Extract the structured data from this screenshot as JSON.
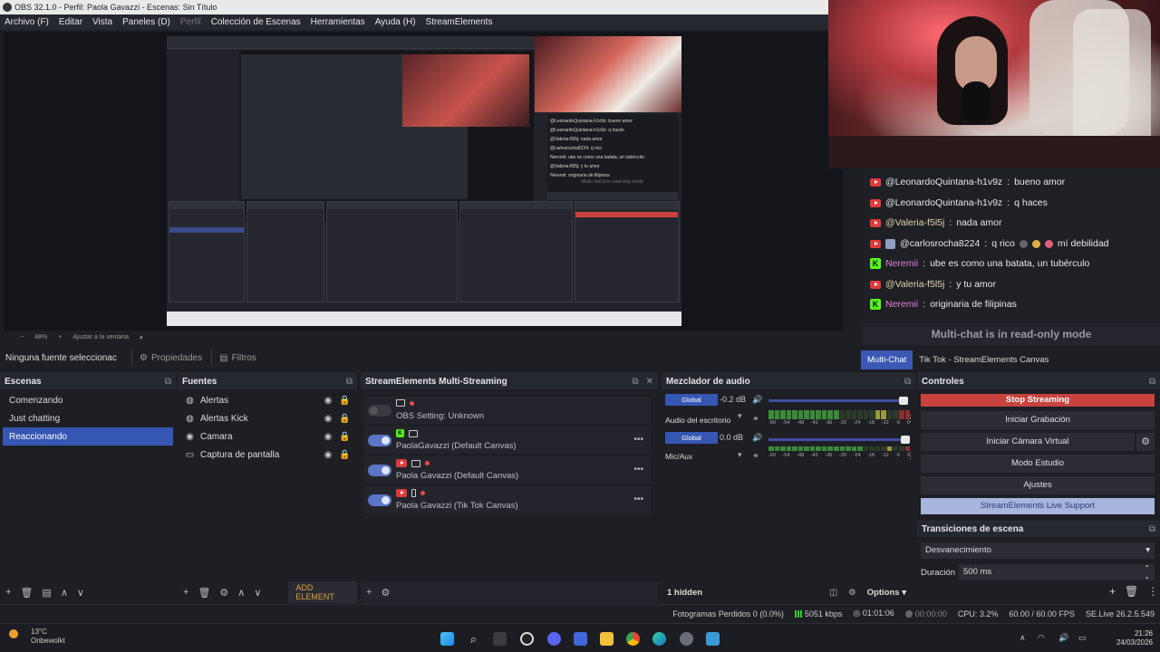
{
  "window": {
    "title": "OBS 32.1.0 - Perfil: Paola Gavazzi - Escenas: Sin Título"
  },
  "menu": {
    "items": [
      "Archivo (F)",
      "Editar",
      "Vista",
      "Paneles (D)",
      "Perfil",
      "Colección de Escenas",
      "Herramientas",
      "Ayuda (H)",
      "StreamElements"
    ]
  },
  "preview": {
    "zoom": "48%",
    "fit_label": "Ajustar a la ventana",
    "nested_chat": [
      "@LeonardoQuintana-h1v9z: bueno amor",
      "@LeonardoQuintana-h1v9z: q hacés",
      "@Valeria-f5l5j: nada amor",
      "@carlosrocha8224: q rico",
      "Neremii: ube es como una batata, un tubérculo",
      "@Valeria-f5l5j: y tu amor",
      "Neremii: originaria de filipinas"
    ],
    "nested_readonly": "Multi-chat is in read-only mode"
  },
  "chat": {
    "messages": [
      {
        "platform": "youtube",
        "user": "@LeonardoQuintana-h1v9z",
        "text": "bueno amor"
      },
      {
        "platform": "youtube",
        "user": "@LeonardoQuintana-h1v9z",
        "text": "q haces"
      },
      {
        "platform": "youtube",
        "user": "@Valeria-f5l5j",
        "text": "nada amor"
      },
      {
        "platform": "youtube",
        "user": "@carlosrocha8224",
        "text": "q rico",
        "text2": "mí debilidad"
      },
      {
        "platform": "kick",
        "user": "Neremii",
        "text": "ube es como una batata, un tubérculo"
      },
      {
        "platform": "youtube",
        "user": "@Valeria-f5l5j",
        "text": "y tu amor"
      },
      {
        "platform": "kick",
        "user": "Neremii",
        "text": "originaria de filipinas"
      }
    ],
    "readonly": "Multi-chat is in read-only mode",
    "tabs": [
      "Multi-Chat",
      "Tik Tok - StreamElements Canvas"
    ]
  },
  "source_toolbar": {
    "no_source": "Ninguna fuente seleccionac",
    "properties": "Propiedades",
    "filters": "Filtros"
  },
  "scenes": {
    "title": "Escenas",
    "items": [
      "Comenzando",
      "Just chatting",
      "Reaccionando"
    ],
    "selected": 2
  },
  "sources": {
    "title": "Fuentes",
    "items": [
      {
        "name": "Alertas",
        "icon": "browser-icon"
      },
      {
        "name": "Alertas Kick",
        "icon": "browser-icon"
      },
      {
        "name": "Camara",
        "icon": "camera-icon"
      },
      {
        "name": "Captura de pantalla",
        "icon": "monitor-icon"
      }
    ],
    "add_element": "ADD ELEMENT"
  },
  "multistream": {
    "title": "StreamElements Multi-Streaming",
    "rows": [
      {
        "label": "OBS Setting: Unknown",
        "enabled": false,
        "platform": "obs"
      },
      {
        "label": "PaolaGavazzi (Default Canvas)",
        "enabled": true,
        "platform": "kick"
      },
      {
        "label": "Paola Gavazzi (Default Canvas)",
        "enabled": true,
        "platform": "youtube"
      },
      {
        "label": "Paola Gavazzi (Tik Tok Canvas)",
        "enabled": true,
        "platform": "youtube"
      }
    ]
  },
  "mixer": {
    "title": "Mezclador de audio",
    "channels": [
      {
        "scope": "Global",
        "db": "-0.2 dB",
        "name": "Audio del escritorio",
        "level": 0.99
      },
      {
        "scope": "Global",
        "db": "0.0 dB",
        "name": "Mic/Aux",
        "level": 1.0
      }
    ],
    "scale": [
      "-60",
      "-54",
      "-48",
      "-42",
      "-36",
      "-30",
      "-24",
      "-18",
      "-12",
      "-6",
      "0"
    ],
    "hidden": "1 hidden",
    "options": "Options"
  },
  "controls": {
    "title": "Controles",
    "stop_streaming": "Stop Streaming",
    "start_recording": "Iniciar Grabación",
    "virtual_cam": "Iniciar Cámara Virtual",
    "studio_mode": "Modo Estudio",
    "settings": "Ajustes",
    "live_support": "StreamElements Live Support"
  },
  "transitions": {
    "title": "Transiciones de escena",
    "selected": "Desvanecimiento",
    "duration_label": "Duración",
    "duration": "500 ms"
  },
  "status": {
    "dropped": "Fotogramas Perdidos 0 (0.0%)",
    "bitrate": "5051 kbps",
    "live_time": "01:01:06",
    "rec_time": "00:00:00",
    "cpu": "CPU: 3.2%",
    "fps": "60.00 / 60.00 FPS",
    "version": "SE.Live 26.2.5.549"
  },
  "taskbar": {
    "temp": "13°C",
    "weather": "Onbewolkt",
    "time": "21:26",
    "date": "24/03/2026"
  },
  "colors": {
    "accent": "#3656b4",
    "stop": "#c8423e",
    "kick": "#53fc18",
    "youtube": "#e03a3a"
  }
}
